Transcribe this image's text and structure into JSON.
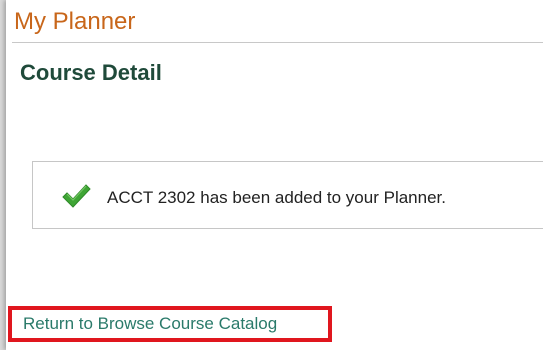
{
  "app": {
    "title": "My Planner"
  },
  "page": {
    "title": "Course Detail"
  },
  "message": {
    "icon": "checkmark-icon",
    "text": "ACCT 2302 has been added to your Planner."
  },
  "navigation": {
    "return_link_label": "Return to Browse Course Catalog"
  },
  "colors": {
    "app_title": "#c8661a",
    "page_title": "#1f4a3a",
    "check": "#3fa535",
    "link": "#2a7a6a",
    "highlight": "#e0161e"
  }
}
